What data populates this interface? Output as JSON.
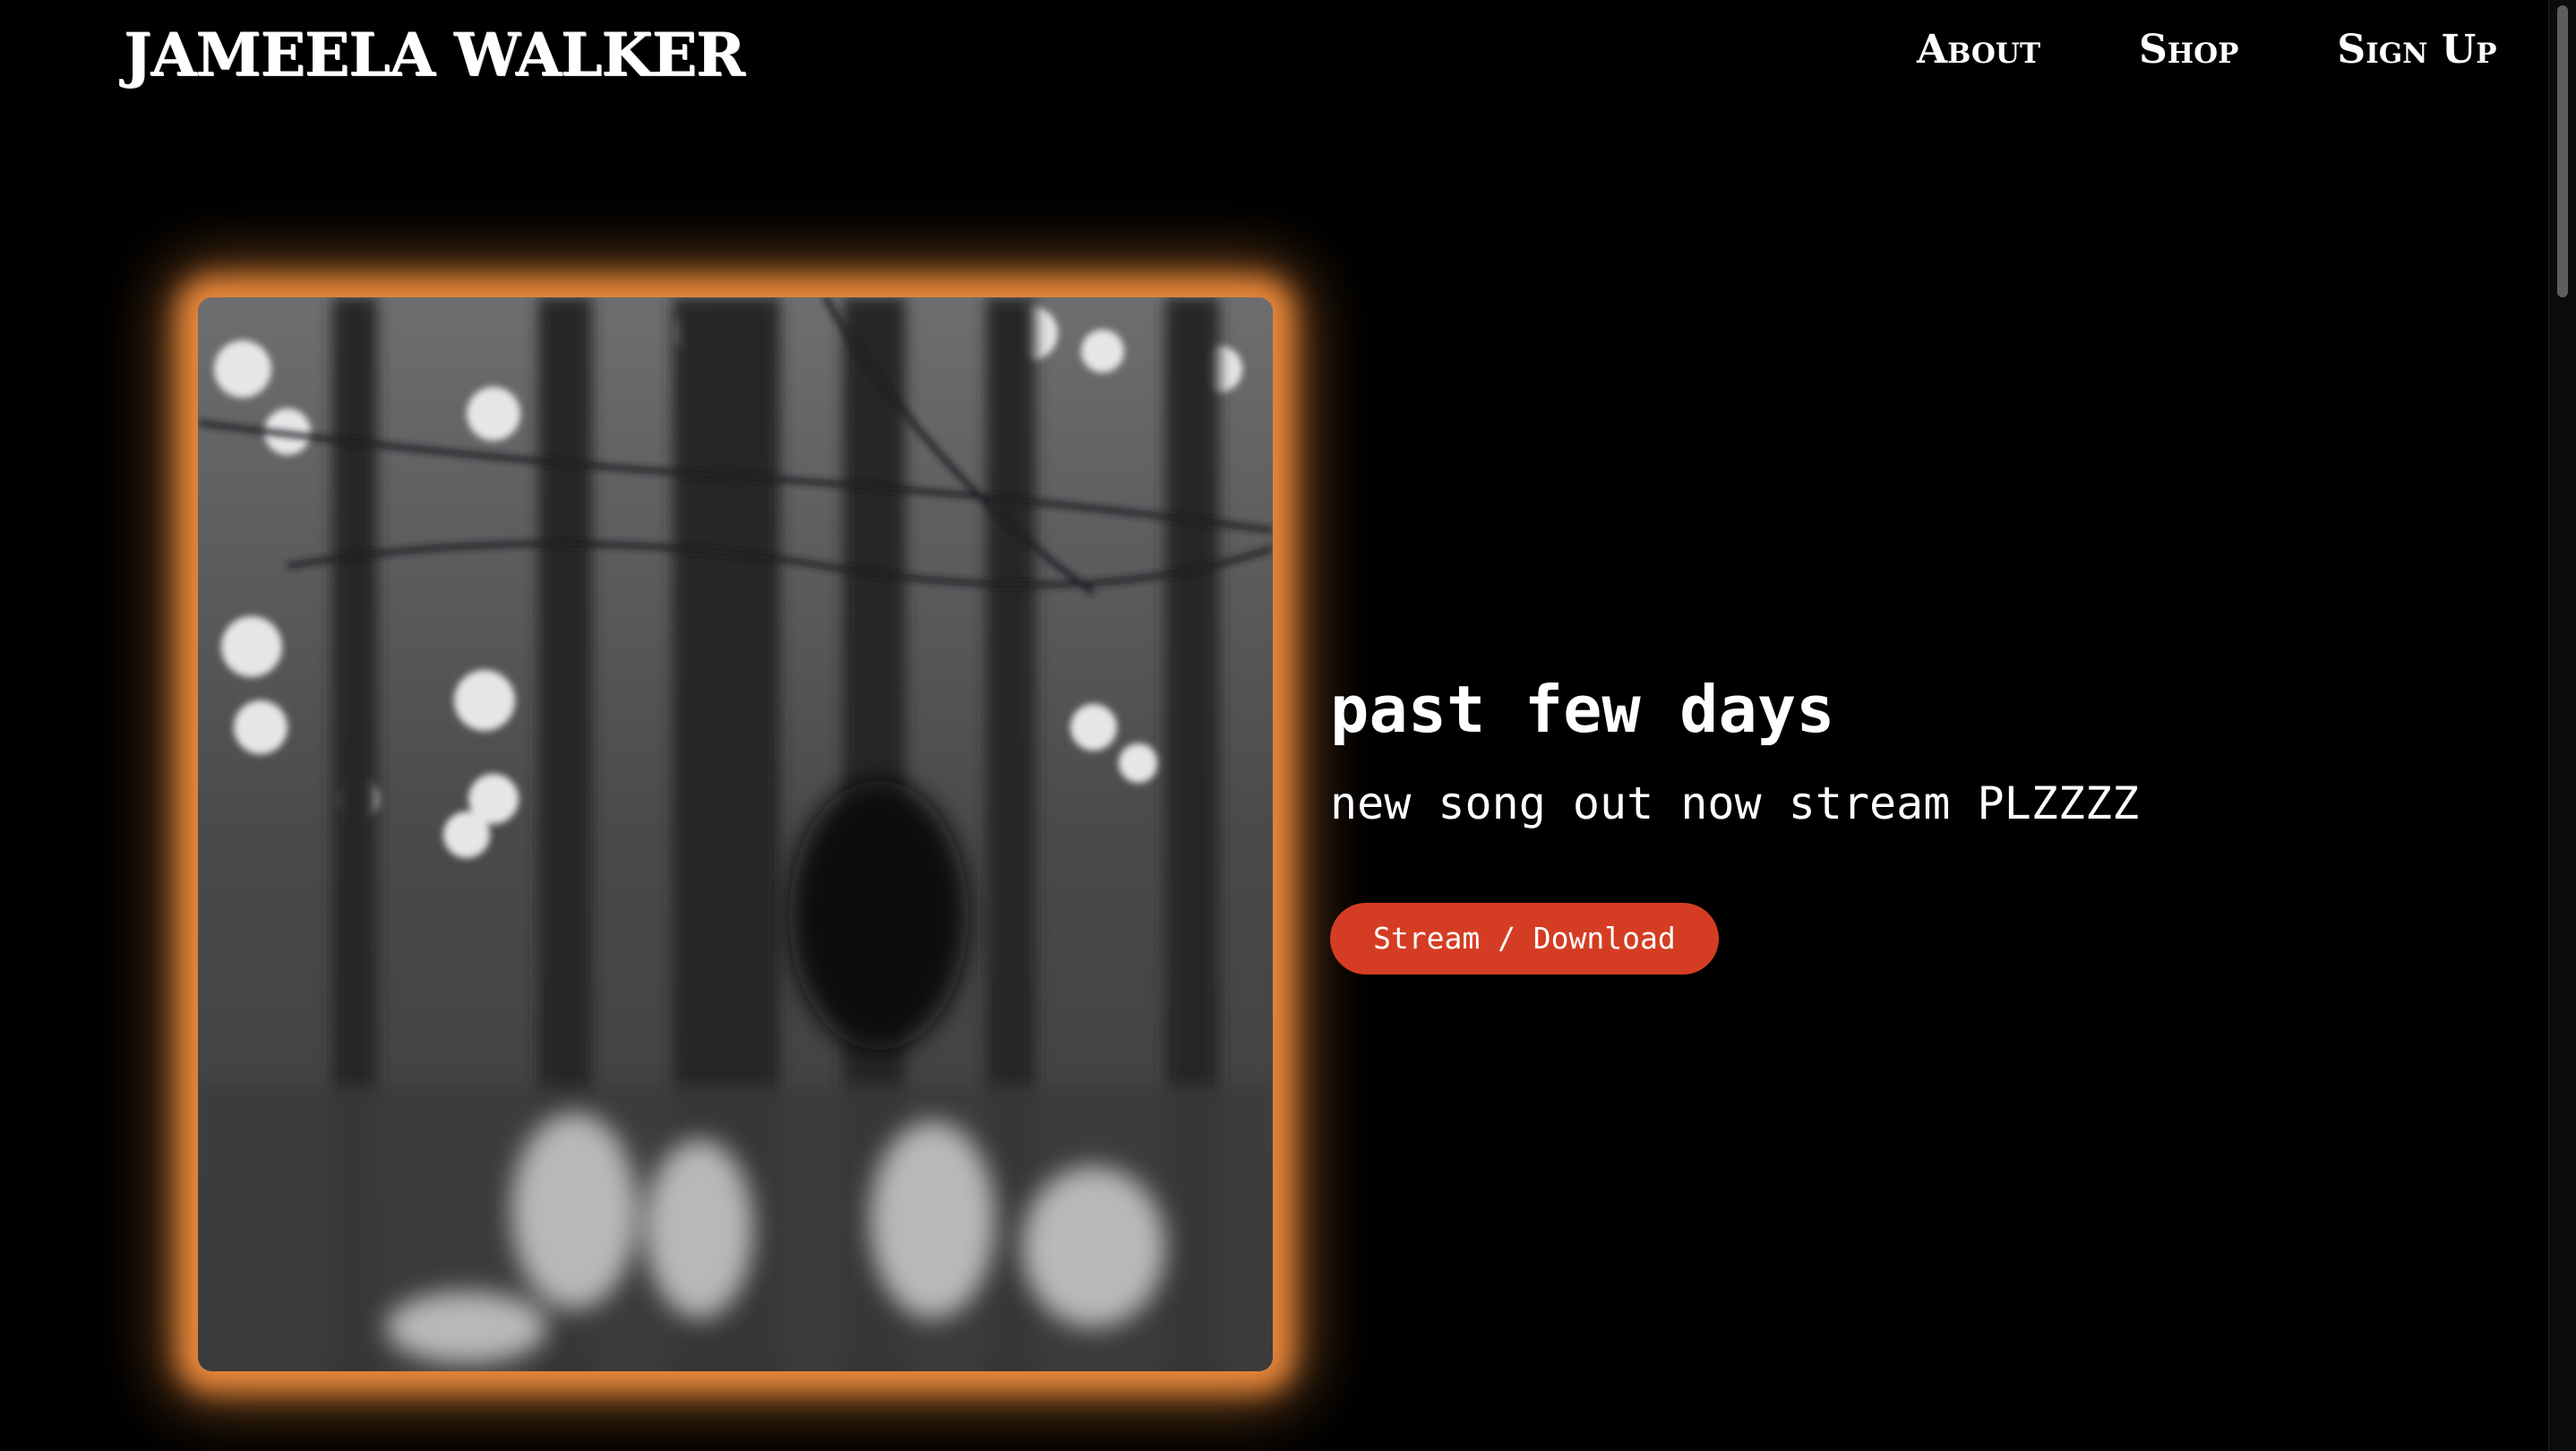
{
  "header": {
    "logo": "JAMEELA WALKER",
    "nav": [
      {
        "label": "About"
      },
      {
        "label": "Shop"
      },
      {
        "label": "Sign Up"
      }
    ]
  },
  "release": {
    "title": "past few days",
    "subtitle": "new song out now stream PLZZZZ",
    "cta_label": "Stream / Download"
  },
  "colors": {
    "background": "#000000",
    "glow": "#e8883b",
    "cta": "#d43d23"
  }
}
